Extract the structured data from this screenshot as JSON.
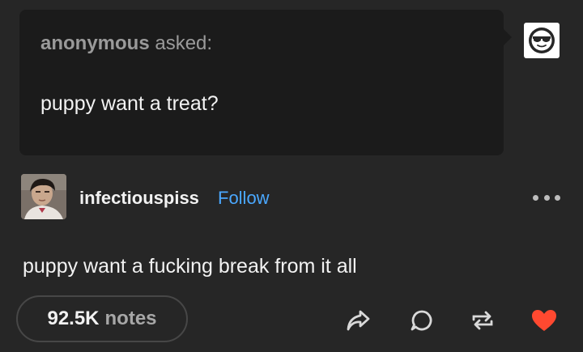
{
  "ask": {
    "asker": "anonymous",
    "verb": "asked:",
    "question": "puppy want a treat?",
    "asker_avatar_icon": "anonymous-sunglasses-icon"
  },
  "author": {
    "username": "infectiouspiss",
    "follow_label": "Follow",
    "avatar_icon": "author-avatar"
  },
  "answer": {
    "text": "puppy want a fucking break from it all"
  },
  "footer": {
    "notes_count": "92.5K",
    "notes_label": "notes",
    "actions": [
      "share-icon",
      "reply-icon",
      "reblog-icon",
      "like-heart-icon"
    ]
  },
  "colors": {
    "background": "#262626",
    "ask_bubble": "#1b1b1b",
    "follow_link": "#4aa8ff",
    "like_heart": "#ff4930"
  }
}
